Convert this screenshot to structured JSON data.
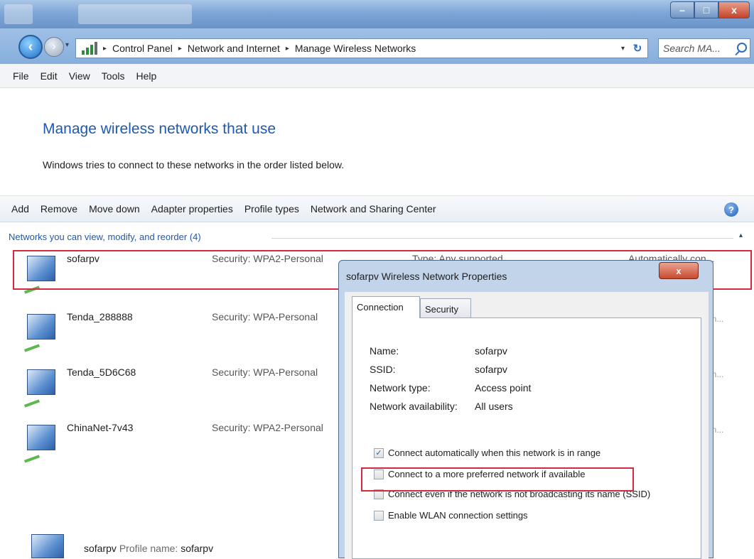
{
  "window": {
    "min_label": "–",
    "max_label": "□",
    "close_label": "x"
  },
  "address": {
    "crumbs": [
      "Control Panel",
      "Network and Internet",
      "Manage Wireless Networks"
    ],
    "sep": "▸",
    "search_placeholder": "Search MA..."
  },
  "menu": [
    "File",
    "Edit",
    "View",
    "Tools",
    "Help"
  ],
  "header": {
    "title": "Manage wireless networks that use",
    "subtitle": "Windows tries to connect to these networks in the order listed below."
  },
  "toolbar": [
    "Add",
    "Remove",
    "Move down",
    "Adapter properties",
    "Profile types",
    "Network and Sharing Center"
  ],
  "group": {
    "label": "Networks you can view, modify, and reorder (4)"
  },
  "networks": [
    {
      "name": "sofarpv",
      "security": "Security: WPA2-Personal",
      "type": "Type: Any supported",
      "auto": "Automatically con..."
    },
    {
      "name": "Tenda_288888",
      "security": "Security: WPA-Personal",
      "auto_clip": "on..."
    },
    {
      "name": "Tenda_5D6C68",
      "security": "Security: WPA-Personal",
      "auto_clip": "on..."
    },
    {
      "name": "ChinaNet-7v43",
      "security": "Security: WPA2-Personal",
      "auto_clip": "on..."
    }
  ],
  "status": {
    "name": "sofarpv",
    "label": "Profile name:",
    "value": "sofarpv"
  },
  "dialog": {
    "title": "sofarpv Wireless Network Properties",
    "close_label": "x",
    "tabs": [
      "Connection",
      "Security"
    ],
    "props": [
      {
        "label": "Name:",
        "value": "sofarpv"
      },
      {
        "label": "SSID:",
        "value": "sofarpv"
      },
      {
        "label": "Network type:",
        "value": "Access point"
      },
      {
        "label": "Network availability:",
        "value": "All users"
      }
    ],
    "checkboxes": [
      {
        "label": "Connect automatically when this network is in range",
        "checked": true
      },
      {
        "label": "Connect to a more preferred network if available",
        "checked": false
      },
      {
        "label": "Connect even if the network is not broadcasting its name (SSID)",
        "checked": false
      },
      {
        "label": "Enable WLAN connection settings",
        "checked": false
      }
    ]
  },
  "colors": {
    "accent_blue": "#1f58b0",
    "highlight_red": "#d22b3d"
  }
}
